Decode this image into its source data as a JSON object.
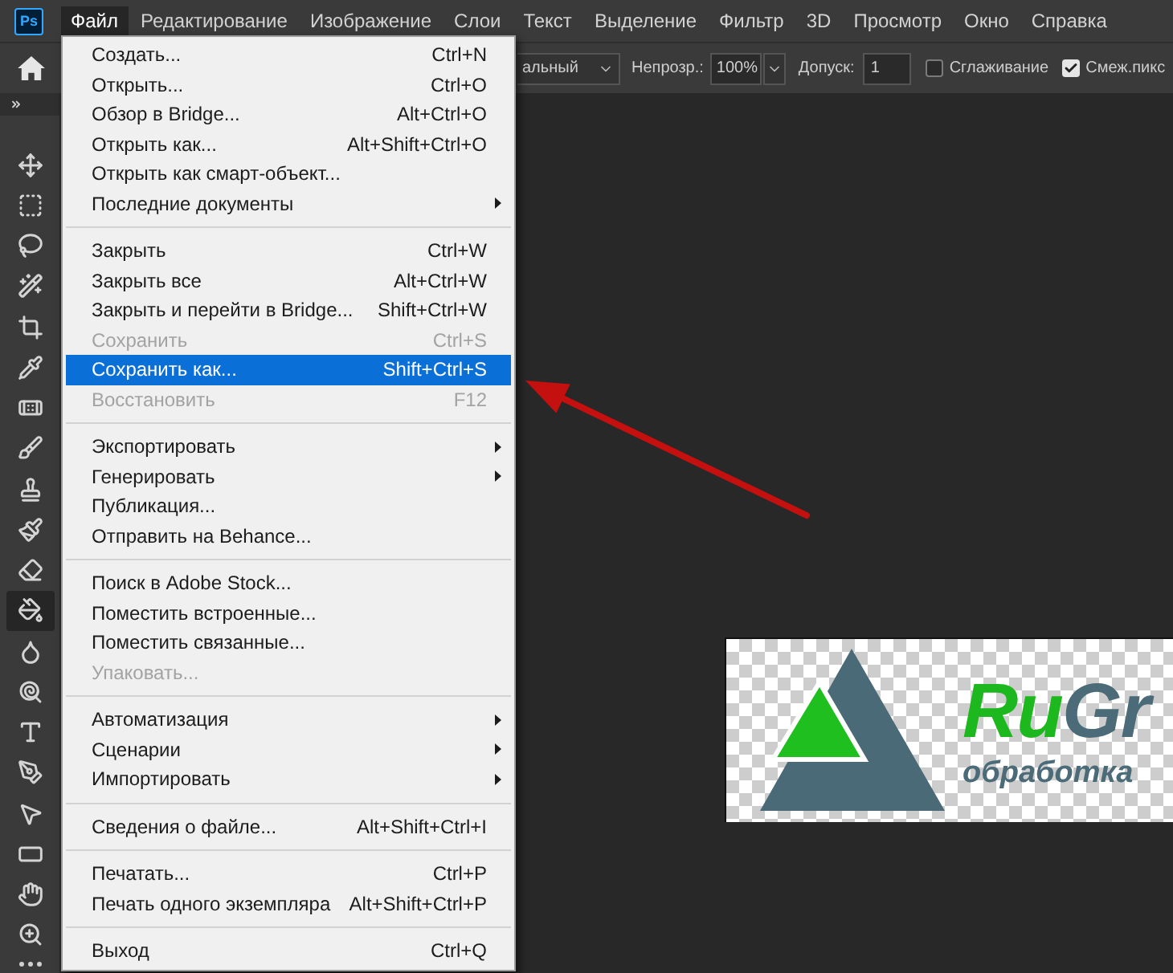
{
  "app_logo": "Ps",
  "menu_bar": [
    {
      "label": "Файл",
      "selected": true
    },
    {
      "label": "Редактирование",
      "selected": false
    },
    {
      "label": "Изображение",
      "selected": false
    },
    {
      "label": "Слои",
      "selected": false
    },
    {
      "label": "Текст",
      "selected": false
    },
    {
      "label": "Выделение",
      "selected": false
    },
    {
      "label": "Фильтр",
      "selected": false
    },
    {
      "label": "3D",
      "selected": false
    },
    {
      "label": "Просмотр",
      "selected": false
    },
    {
      "label": "Окно",
      "selected": false
    },
    {
      "label": "Справка",
      "selected": false
    }
  ],
  "options_bar": {
    "blend_mode": {
      "value": "альный"
    },
    "opacity": {
      "label": "Непрозр.:",
      "value": "100%"
    },
    "tolerance": {
      "label": "Допуск:",
      "value": "1"
    },
    "anti_alias": {
      "label": "Сглаживание",
      "checked": false
    },
    "contiguous": {
      "label": "Смеж.пикс",
      "checked": true
    }
  },
  "tools": [
    {
      "kind": "move",
      "selected": false
    },
    {
      "kind": "marquee",
      "selected": false
    },
    {
      "kind": "lasso",
      "selected": false
    },
    {
      "kind": "quick_select",
      "selected": false
    },
    {
      "kind": "crop",
      "selected": false
    },
    {
      "kind": "eyedropper",
      "selected": false
    },
    {
      "kind": "healing",
      "selected": false
    },
    {
      "kind": "brush",
      "selected": false
    },
    {
      "kind": "stamp",
      "selected": false
    },
    {
      "kind": "history_brush",
      "selected": false
    },
    {
      "kind": "eraser",
      "selected": false
    },
    {
      "kind": "paint_bucket",
      "selected": true
    },
    {
      "kind": "blur",
      "selected": false
    },
    {
      "kind": "dodge",
      "selected": false
    },
    {
      "kind": "type",
      "selected": false
    },
    {
      "kind": "pen",
      "selected": false
    },
    {
      "kind": "path_select",
      "selected": false
    },
    {
      "kind": "rectangle",
      "selected": false
    },
    {
      "kind": "hand",
      "selected": false
    },
    {
      "kind": "zoom",
      "selected": false
    },
    {
      "kind": "more",
      "selected": false
    }
  ],
  "file_menu": {
    "groups": [
      {
        "items": [
          {
            "label": "Создать...",
            "shortcut": "Ctrl+N",
            "submenu": false,
            "disabled": false,
            "selected": false
          },
          {
            "label": "Открыть...",
            "shortcut": "Ctrl+O",
            "submenu": false,
            "disabled": false,
            "selected": false
          },
          {
            "label": "Обзор в Bridge...",
            "shortcut": "Alt+Ctrl+O",
            "submenu": false,
            "disabled": false,
            "selected": false
          },
          {
            "label": "Открыть как...",
            "shortcut": "Alt+Shift+Ctrl+O",
            "submenu": false,
            "disabled": false,
            "selected": false
          },
          {
            "label": "Открыть как смарт-объект...",
            "submenu": false,
            "disabled": false,
            "selected": false
          },
          {
            "label": "Последние документы",
            "submenu": true,
            "disabled": false,
            "selected": false
          }
        ]
      },
      {
        "items": [
          {
            "label": "Закрыть",
            "shortcut": "Ctrl+W",
            "submenu": false,
            "disabled": false,
            "selected": false
          },
          {
            "label": "Закрыть все",
            "shortcut": "Alt+Ctrl+W",
            "submenu": false,
            "disabled": false,
            "selected": false
          },
          {
            "label": "Закрыть и перейти в Bridge...",
            "shortcut": "Shift+Ctrl+W",
            "submenu": false,
            "disabled": false,
            "selected": false
          },
          {
            "label": "Сохранить",
            "shortcut": "Ctrl+S",
            "submenu": false,
            "disabled": true,
            "selected": false
          },
          {
            "label": "Сохранить как...",
            "shortcut": "Shift+Ctrl+S",
            "submenu": false,
            "disabled": false,
            "selected": true
          },
          {
            "label": "Восстановить",
            "shortcut": "F12",
            "submenu": false,
            "disabled": true,
            "selected": false
          }
        ]
      },
      {
        "items": [
          {
            "label": "Экспортировать",
            "submenu": true,
            "disabled": false,
            "selected": false
          },
          {
            "label": "Генерировать",
            "submenu": true,
            "disabled": false,
            "selected": false
          },
          {
            "label": "Публикация...",
            "submenu": false,
            "disabled": false,
            "selected": false
          },
          {
            "label": "Отправить на Behance...",
            "submenu": false,
            "disabled": false,
            "selected": false
          }
        ]
      },
      {
        "items": [
          {
            "label": "Поиск в Adobe Stock...",
            "submenu": false,
            "disabled": false,
            "selected": false
          },
          {
            "label": "Поместить встроенные...",
            "submenu": false,
            "disabled": false,
            "selected": false
          },
          {
            "label": "Поместить связанные...",
            "submenu": false,
            "disabled": false,
            "selected": false
          },
          {
            "label": "Упаковать...",
            "submenu": false,
            "disabled": true,
            "selected": false
          }
        ]
      },
      {
        "items": [
          {
            "label": "Автоматизация",
            "submenu": true,
            "disabled": false,
            "selected": false
          },
          {
            "label": "Сценарии",
            "submenu": true,
            "disabled": false,
            "selected": false
          },
          {
            "label": "Импортировать",
            "submenu": true,
            "disabled": false,
            "selected": false
          }
        ]
      },
      {
        "items": [
          {
            "label": "Сведения о файле...",
            "shortcut": "Alt+Shift+Ctrl+I",
            "submenu": false,
            "disabled": false,
            "selected": false
          }
        ]
      },
      {
        "items": [
          {
            "label": "Печатать...",
            "shortcut": "Ctrl+P",
            "submenu": false,
            "disabled": false,
            "selected": false
          },
          {
            "label": "Печать одного экземпляра",
            "shortcut": "Alt+Shift+Ctrl+P",
            "submenu": false,
            "disabled": false,
            "selected": false
          }
        ]
      },
      {
        "items": [
          {
            "label": "Выход",
            "shortcut": "Ctrl+Q",
            "submenu": false,
            "disabled": false,
            "selected": false
          }
        ]
      }
    ]
  },
  "document": {
    "logo": {
      "title": [
        "Ru",
        "Gr"
      ],
      "tagline": "обработка"
    }
  }
}
